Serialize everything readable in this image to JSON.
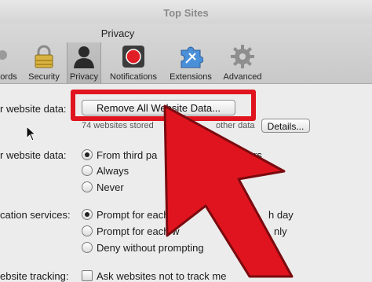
{
  "window": {
    "title": "Top Sites"
  },
  "toolbar": {
    "pane_title": "Privacy",
    "items": [
      {
        "label": "ords",
        "icon": "passwords-icon"
      },
      {
        "label": "Security",
        "icon": "lock-icon"
      },
      {
        "label": "Privacy",
        "icon": "person-silhouette-icon",
        "selected": true
      },
      {
        "label": "Notifications",
        "icon": "record-button-icon"
      },
      {
        "label": "Extensions",
        "icon": "puzzle-icon"
      },
      {
        "label": "Advanced",
        "icon": "gear-icon"
      }
    ]
  },
  "privacy": {
    "cookies_label": "r website data:",
    "remove_button": "Remove All Website Data...",
    "stored_info": "74 websites stored",
    "stored_info_tail": "other data",
    "details_button": "Details...",
    "block_label": "r website data:",
    "block_options": [
      {
        "label": "From third pa",
        "tail": "rs",
        "checked": true
      },
      {
        "label": "Always",
        "checked": false
      },
      {
        "label": "Never",
        "checked": false
      }
    ],
    "location_label": "cation services:",
    "location_options": [
      {
        "label": "Prompt for each",
        "tail": "h day",
        "checked": true
      },
      {
        "label": "Prompt for each w",
        "tail": "nly",
        "checked": false
      },
      {
        "label": "Deny without prompting",
        "checked": false
      }
    ],
    "tracking_label": "ebsite tracking:",
    "tracking_option": "Ask websites not to track me"
  },
  "colors": {
    "highlight": "#e0141e",
    "arrow": "#e0141e"
  }
}
